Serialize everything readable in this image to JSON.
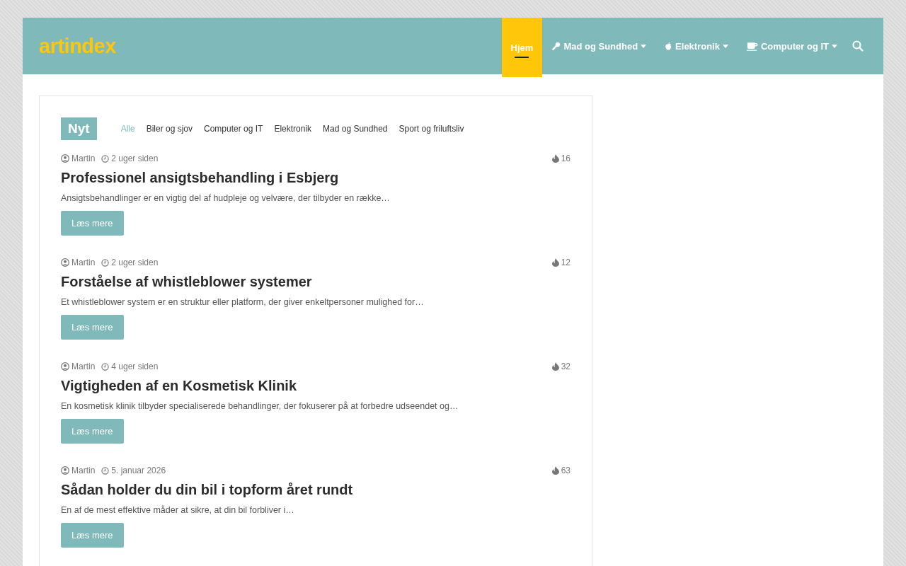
{
  "logo": "artindex",
  "nav": [
    {
      "label": "Hjem",
      "selected": true,
      "dropdown": false
    },
    {
      "label": "Mad og Sundhed",
      "selected": false,
      "dropdown": true
    },
    {
      "label": "Elektronik",
      "selected": false,
      "dropdown": true
    },
    {
      "label": "Computer og IT",
      "selected": false,
      "dropdown": true
    }
  ],
  "section": {
    "title": "Nyt",
    "filters": [
      {
        "label": "Alle",
        "selected": true
      },
      {
        "label": "Biler og sjov",
        "selected": false
      },
      {
        "label": "Computer og IT",
        "selected": false
      },
      {
        "label": "Elektronik",
        "selected": false
      },
      {
        "label": "Mad og Sundhed",
        "selected": false
      },
      {
        "label": "Sport og friluftsliv",
        "selected": false
      }
    ]
  },
  "posts": [
    {
      "author": "Martin",
      "date": "2 uger siden",
      "views": "16",
      "title": "Professionel ansigtsbehandling i Esbjerg",
      "excerpt": "Ansigtsbehandlinger er en vigtig del af hudpleje og velvære, der tilbyder en række…",
      "button": "Læs mere"
    },
    {
      "author": "Martin",
      "date": "2 uger siden",
      "views": "12",
      "title": "Forståelse af whistleblower systemer",
      "excerpt": "Et whistleblower system er en struktur eller platform, der giver enkeltpersoner mulighed for…",
      "button": "Læs mere"
    },
    {
      "author": "Martin",
      "date": "4 uger siden",
      "views": "32",
      "title": "Vigtigheden af en Kosmetisk Klinik",
      "excerpt": "En kosmetisk klinik tilbyder specialiserede behandlinger, der fokuserer på at forbedre udseendet og…",
      "button": "Læs mere"
    },
    {
      "author": "Martin",
      "date": "5. januar 2026",
      "views": "63",
      "title": "Sådan holder du din bil i topform året rundt",
      "excerpt": "En af de mest effektive måder at sikre, at din bil forbliver i…",
      "button": "Læs mere"
    }
  ]
}
